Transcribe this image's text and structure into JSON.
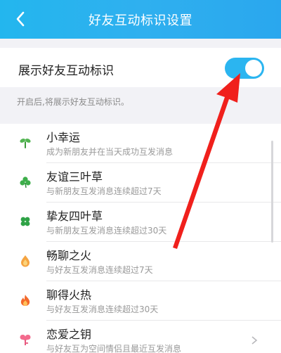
{
  "header": {
    "title": "好友互动标识设置",
    "back_icon": "back-icon"
  },
  "settings": {
    "toggle_label": "展示好友互动标识",
    "toggle_on": true,
    "hint": "开启后,将展示好友互动标识。"
  },
  "items": [
    {
      "title": "小幸运",
      "desc": "成为新朋友并在当天成功互发消息",
      "icon": "sprout-icon"
    },
    {
      "title": "友谊三叶草",
      "desc": "与新朋友互发消息连续超过7天",
      "icon": "three-leaf-clover-icon"
    },
    {
      "title": "挚友四叶草",
      "desc": "与新朋友互发消息连续超过30天",
      "icon": "four-leaf-clover-icon"
    },
    {
      "title": "畅聊之火",
      "desc": "与好友互发消息连续超过7天",
      "icon": "small-flame-icon"
    },
    {
      "title": "聊得火热",
      "desc": "与好友互发消息连续超过30天",
      "icon": "big-flame-icon"
    },
    {
      "title": "恋爱之钥",
      "desc": "与好友互为空间情侣且最近互发消息",
      "icon": "key-icon"
    }
  ],
  "colors": {
    "header": "#2bb2ee",
    "toggle": "#2bb5f0",
    "annotation_arrow": "#f0201c"
  }
}
